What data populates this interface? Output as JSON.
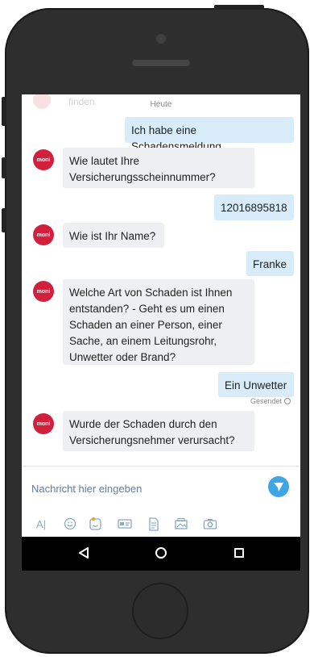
{
  "chat": {
    "ghost_text": "finden",
    "date_label": "Heute",
    "avatar_label": "moni",
    "messages": [
      {
        "from": "user",
        "text": "Ich habe eine Schadensmeldung"
      },
      {
        "from": "bot",
        "text": "Wie lautet Ihre Versicherungsscheinnummer?"
      },
      {
        "from": "user",
        "text": "12016895818"
      },
      {
        "from": "bot",
        "text": "Wie ist Ihr Name?"
      },
      {
        "from": "user",
        "text": "Franke"
      },
      {
        "from": "bot",
        "text": "Welche Art von Schaden ist Ihnen entstanden? - Geht es um einen Schaden an einer Person, einer Sache, an einem Leitungsrohr, Unwetter oder Brand?"
      },
      {
        "from": "user",
        "text": "Ein Unwetter"
      },
      {
        "from": "bot",
        "text": "Wurde der Schaden durch den Versicherungsnehmer verursacht?"
      }
    ],
    "sent_status": "Gesendet"
  },
  "input": {
    "placeholder": "Nachricht hier eingeben"
  },
  "toolbar": {
    "icons": [
      "text-format-icon",
      "emoji-icon",
      "sticker-icon",
      "card-icon",
      "document-icon",
      "gallery-icon",
      "camera-icon"
    ],
    "text_format_glyph": "A|"
  },
  "colors": {
    "user_bubble": "#d7ecf8",
    "bot_bubble": "#edeff2",
    "avatar": "#d21f3c",
    "send_button": "#3ea6e6",
    "phone_body": "#2e2e2e"
  }
}
